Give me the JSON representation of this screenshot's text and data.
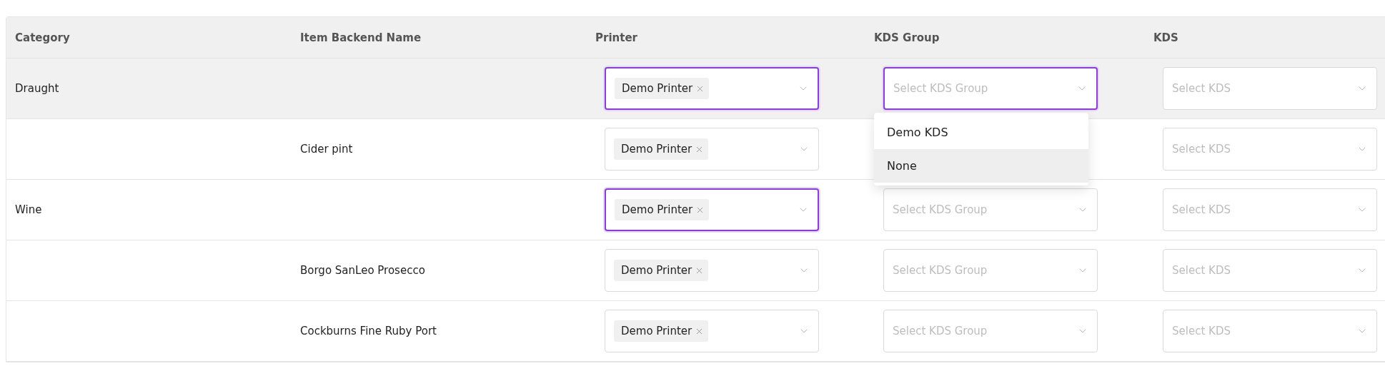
{
  "table": {
    "columns": [
      "Category",
      "Item Backend Name",
      "Printer",
      "KDS Group",
      "KDS"
    ],
    "rows": [
      {
        "category": "Draught",
        "item_name": "",
        "highlighted": true,
        "printer": {
          "tags": [
            "Demo Printer"
          ],
          "focused": true
        },
        "kds_group": {
          "placeholder": "Select KDS Group",
          "focused": true,
          "options": [
            {
              "label": "Demo KDS",
              "selected": false
            },
            {
              "label": "None",
              "selected": true
            }
          ]
        },
        "kds": {
          "placeholder": "Select KDS",
          "focused": false
        }
      },
      {
        "category": "",
        "item_name": "Cider pint",
        "highlighted": false,
        "printer": {
          "tags": [
            "Demo Printer"
          ],
          "focused": false
        },
        "kds": {
          "placeholder": "Select KDS",
          "focused": false
        }
      },
      {
        "category": "Wine",
        "item_name": "",
        "highlighted": false,
        "printer": {
          "tags": [
            "Demo Printer"
          ],
          "focused": true
        },
        "kds_group": {
          "placeholder": "Select KDS Group",
          "focused": false
        },
        "kds": {
          "placeholder": "Select KDS",
          "focused": false
        }
      },
      {
        "category": "",
        "item_name": "Borgo SanLeo Prosecco",
        "highlighted": false,
        "printer": {
          "tags": [
            "Demo Printer"
          ],
          "focused": false
        },
        "kds_group": {
          "placeholder": "Select KDS Group",
          "focused": false
        },
        "kds": {
          "placeholder": "Select KDS",
          "focused": false
        }
      },
      {
        "category": "",
        "item_name": "Cockburns Fine Ruby Port",
        "highlighted": false,
        "printer": {
          "tags": [
            "Demo Printer"
          ],
          "focused": false
        },
        "kds_group": {
          "placeholder": "Select KDS Group",
          "focused": false
        },
        "kds": {
          "placeholder": "Select KDS",
          "focused": false
        }
      }
    ]
  }
}
